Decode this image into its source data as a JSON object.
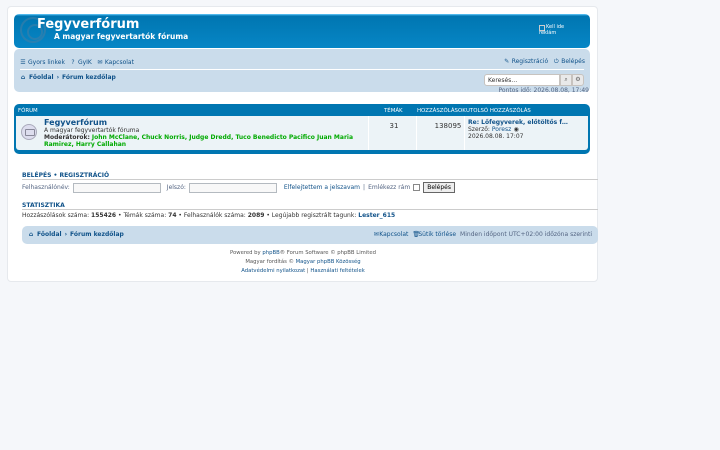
{
  "header": {
    "site_title": "Fegyverfórum",
    "site_description": "A magyar fegyvertartók fóruma",
    "sponsor_alt": "Kell ide reklám"
  },
  "nav": {
    "quick_links": "Gyors linkek",
    "faq": "GyIK",
    "contact": "Kapcsolat",
    "register": "Regisztráció",
    "login": "Belépés",
    "crumb_home": "Főoldal",
    "crumb_index": "Fórum kezdőlap",
    "search_placeholder": "Keresés…"
  },
  "time_line": "Pontos idő: 2026.08.08, 17:49",
  "forum_table": {
    "col_forum": "FÓRUM",
    "col_topics": "TÉMÁK",
    "col_posts": "HOZZÁSZÓLÁSOK",
    "col_last": "UTOLSÓ HOZZÁSZÓLÁS",
    "row": {
      "name": "Fegyverfórum",
      "description": "A magyar fegyvertartók fóruma",
      "moderators_label": "Moderátorok:",
      "moderators": "John McClane, Chuck Norris, Judge Dredd, Tuco Benedicto Pacifico Juan Maria Ramirez, Harry Callahan",
      "topics": "31",
      "posts": "138095",
      "last_title": "Re: Lőfegyverek, előtöltős f…",
      "last_by_label": "Szerző:",
      "last_author": "Poresz",
      "last_date": "2026.08.08. 17:07"
    }
  },
  "login_section": {
    "heading": "BELÉPÉS",
    "sep": "•",
    "register": "REGISZTRÁCIÓ",
    "username_label": "Felhasználónév:",
    "password_label": "Jelszó:",
    "forgot": "Elfelejtettem a jelszavam",
    "pipe": "|",
    "remember": "Emlékezz rám",
    "login_button": "Belépés"
  },
  "stats": {
    "heading": "STATISZTIKA",
    "posts_label": "Hozzászólások száma:",
    "posts_value": "155426",
    "topics_label": "• Témák száma:",
    "topics_value": "74",
    "users_label": "• Felhasználók száma:",
    "users_value": "2089",
    "newest_label": "• Legújabb regisztrált tagunk:",
    "newest_value": "Lester_615"
  },
  "footer_nav": {
    "crumb_home": "Főoldal",
    "crumb_index": "Fórum kezdőlap",
    "contact": "Kapcsolat",
    "cookies": "Sütik törlése",
    "timezone": "Minden időpont UTC+02:00 időzóna szerinti"
  },
  "copyright": {
    "powered_prefix": "Powered by",
    "phpbb": "phpBB",
    "powered_suffix": "® Forum Software © phpBB Limited",
    "translation_prefix": "Magyar fordítás ©",
    "translation_link": "Magyar phpBB Közösség",
    "privacy": "Adatvédelmi nyilatkozat",
    "pipe": "|",
    "terms": "Használati feltételek"
  }
}
